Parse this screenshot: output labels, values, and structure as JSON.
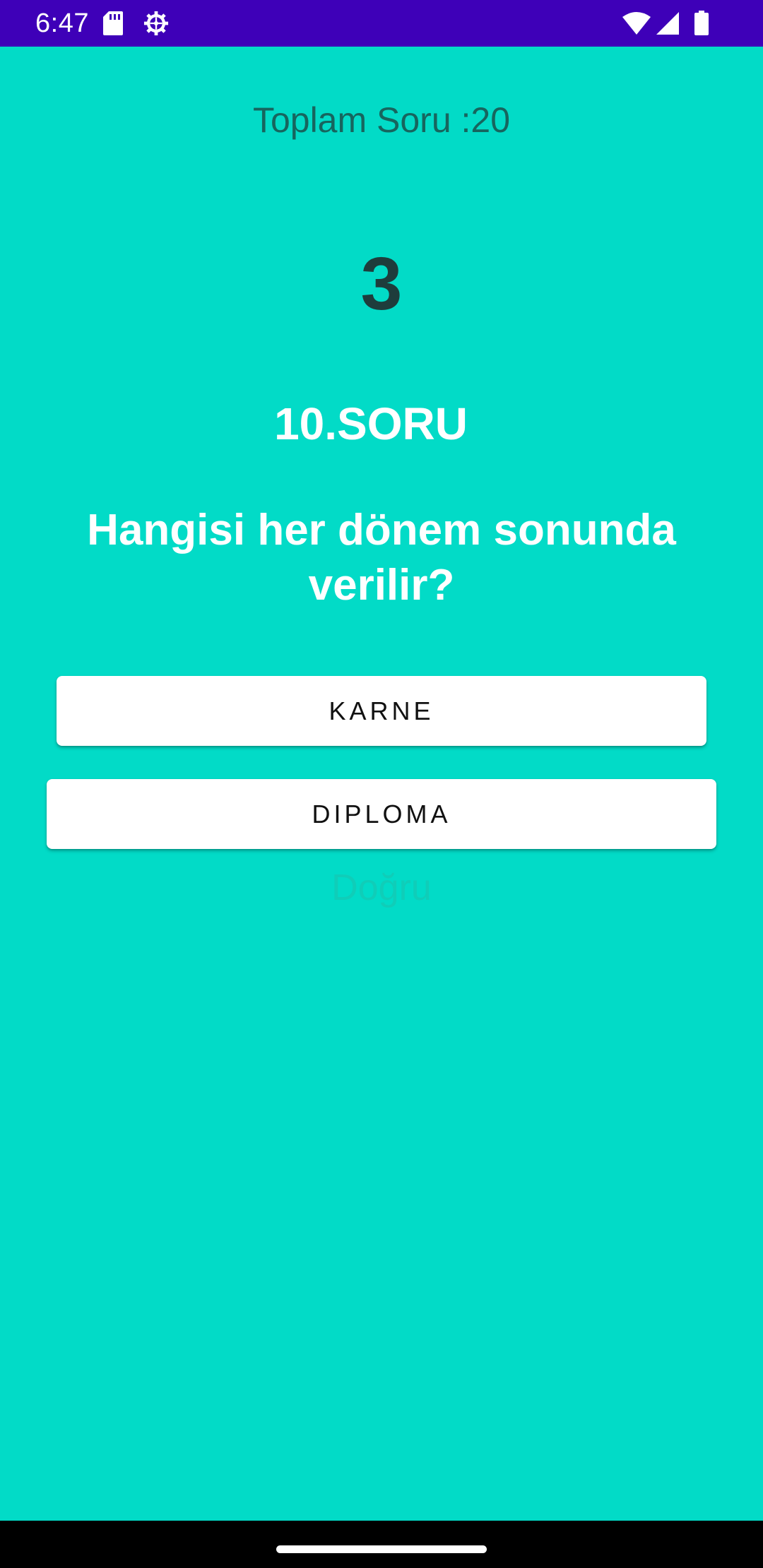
{
  "status_bar": {
    "time": "6:47",
    "icons": [
      "sd-card-icon",
      "gear-icon",
      "wifi-icon",
      "signal-icon",
      "battery-icon"
    ],
    "background": "#3e00b8"
  },
  "quiz": {
    "total_label": "Toplam Soru :20",
    "counter": "3",
    "question_number": "10.SORU",
    "question_text": "Hangisi her dönem sonunda verilir?",
    "answers": [
      {
        "label": "KARNE"
      },
      {
        "label": "DIPLOMA"
      }
    ],
    "result_text": "Doğru"
  },
  "colors": {
    "background": "#02dbc7",
    "button": "#ffffff",
    "counter": "#1e3d3c",
    "total_label": "#17655e",
    "result_text": "#10cdb8"
  }
}
